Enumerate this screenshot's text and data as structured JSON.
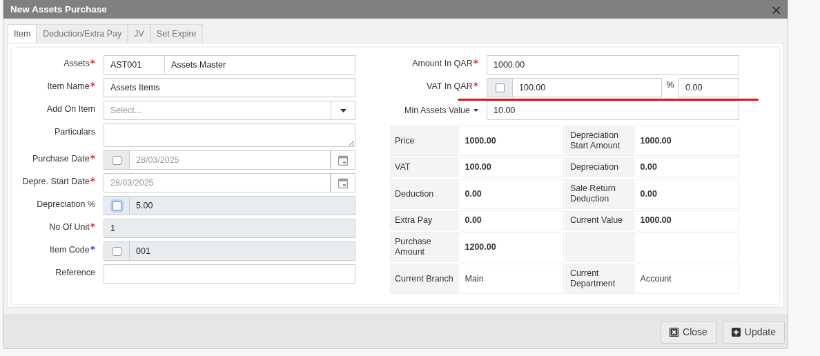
{
  "dialog": {
    "title": "New Assets Purchase",
    "close_icon": "×"
  },
  "tabs": [
    {
      "label": "Item",
      "selected": true
    },
    {
      "label": "Deduction/Extra Pay",
      "selected": false
    },
    {
      "label": "JV",
      "selected": false
    },
    {
      "label": "Set Expire",
      "selected": false
    }
  ],
  "left_fields": [
    {
      "kind": "pair",
      "label": "Assets",
      "marker": {
        "text": "*",
        "color": "#e8202a"
      },
      "code": "AST001",
      "value": "Assets Master"
    },
    {
      "kind": "text",
      "label": "Item Name",
      "marker": {
        "text": "*",
        "color": "#e8202a"
      },
      "value": "Assets Items"
    },
    {
      "kind": "select",
      "label": "Add On Item",
      "placeholder": "Select..."
    },
    {
      "kind": "textarea",
      "label": "Particulars"
    },
    {
      "kind": "checkdate",
      "label": "Purchase Date",
      "marker": {
        "text": "*",
        "color": "#e8202a"
      },
      "checked": false,
      "value": "28/03/2025"
    },
    {
      "kind": "date",
      "label": "Depre. Start Date",
      "marker": {
        "text": "*",
        "color": "#e8202a"
      },
      "value": "28/03/2025"
    },
    {
      "kind": "checktext",
      "label": "Depreciation %",
      "checked": false,
      "focused": true,
      "value": "5.00"
    },
    {
      "kind": "readonly",
      "label": "No Of Unit",
      "marker": {
        "text": "*",
        "color": "#e8202a"
      },
      "value": "1"
    },
    {
      "kind": "checktext",
      "label": "Item Code",
      "marker": {
        "text": "*",
        "color": "#2a3bd8"
      },
      "checked": false,
      "focused": false,
      "value": "001"
    },
    {
      "kind": "text",
      "label": "Reference"
    }
  ],
  "right_fields": [
    {
      "kind": "text",
      "label": "Amount In QAR",
      "marker": {
        "text": "*",
        "color": "#e8202a"
      },
      "value": "1000.00"
    },
    {
      "kind": "vat",
      "label": "VAT In QAR",
      "marker": {
        "text": "*",
        "color": "#e8202a"
      },
      "checked": false,
      "value": "100.00",
      "percent_sign": "%",
      "percent": "0.00",
      "underlined": true
    },
    {
      "kind": "dropdown-label",
      "label": "Min Assets Value",
      "value": "10.00"
    }
  ],
  "summary": [
    {
      "label_1": "Price",
      "value_1": "1000.00",
      "label_2": "Depreciation Start Amount",
      "value_2": "1000.00",
      "bold": true
    },
    {
      "label_1": "VAT",
      "value_1": "100.00",
      "label_2": "Depreciation",
      "value_2": "0.00",
      "bold": true
    },
    {
      "label_1": "Deduction",
      "value_1": "0.00",
      "label_2": "Sale Return Deduction",
      "value_2": "0.00",
      "bold": true
    },
    {
      "label_1": "Extra Pay",
      "value_1": "0.00",
      "label_2": "Current Value",
      "value_2": "1000.00",
      "bold": true
    },
    {
      "label_1": "Purchase Amount",
      "value_1": "1200.00",
      "bold": true
    },
    {
      "label_1": "Current Branch",
      "value_1": "Main",
      "label_2": "Current Department",
      "value_2": "Account",
      "bold": false
    }
  ],
  "buttons": [
    {
      "kind": "close",
      "label": "Close"
    },
    {
      "kind": "update",
      "label": "Update"
    }
  ]
}
